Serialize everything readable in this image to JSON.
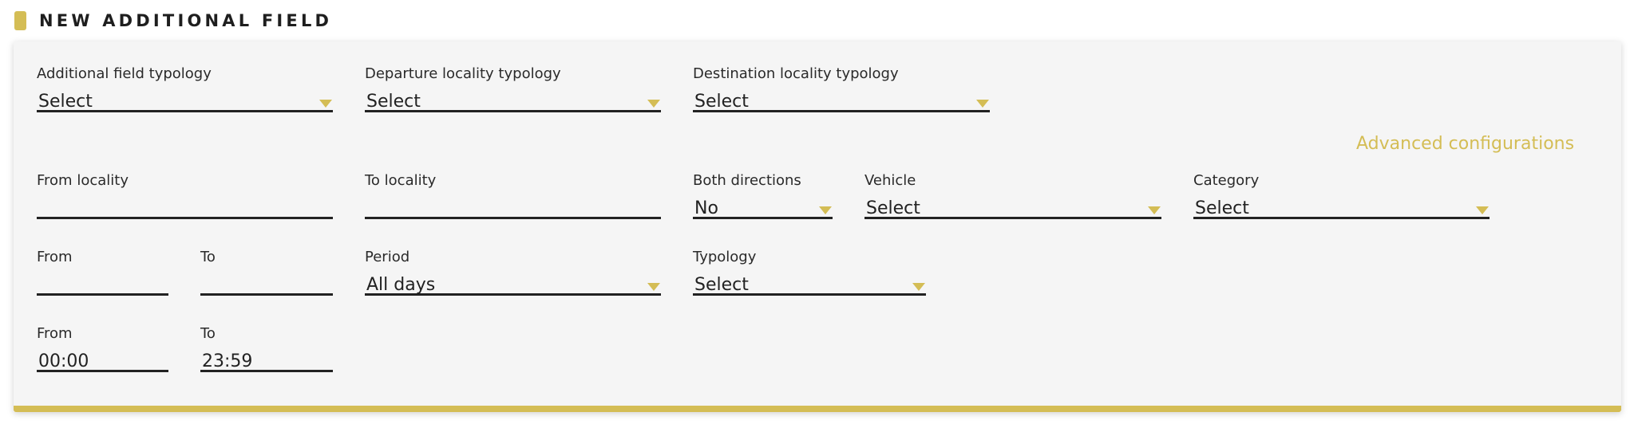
{
  "header": {
    "title": "NEW ADDITIONAL FIELD"
  },
  "colors": {
    "accent": "#d4bd55",
    "panel_bg": "#f5f5f5",
    "text": "#222222"
  },
  "advanced_link": "Advanced configurations",
  "fields": {
    "additional_field_typology": {
      "label": "Additional field typology",
      "value": "Select",
      "type": "select"
    },
    "departure_locality_typology": {
      "label": "Departure locality typology",
      "value": "Select",
      "type": "select"
    },
    "destination_locality_typology": {
      "label": "Destination locality typology",
      "value": "Select",
      "type": "select"
    },
    "from_locality": {
      "label": "From locality",
      "value": "",
      "type": "text"
    },
    "to_locality": {
      "label": "To locality",
      "value": "",
      "type": "text"
    },
    "both_directions": {
      "label": "Both directions",
      "value": "No",
      "type": "select"
    },
    "vehicle": {
      "label": "Vehicle",
      "value": "Select",
      "type": "select"
    },
    "category": {
      "label": "Category",
      "value": "Select",
      "type": "select"
    },
    "date_from": {
      "label": "From",
      "value": "",
      "type": "text"
    },
    "date_to": {
      "label": "To",
      "value": "",
      "type": "text"
    },
    "period": {
      "label": "Period",
      "value": "All days",
      "type": "select"
    },
    "typology": {
      "label": "Typology",
      "value": "Select",
      "type": "select"
    },
    "time_from": {
      "label": "From",
      "value": "00:00",
      "type": "text"
    },
    "time_to": {
      "label": "To",
      "value": "23:59",
      "type": "text"
    }
  },
  "icons": {
    "section_marker": "section-marker-icon",
    "dropdown": "caret-down-icon"
  }
}
